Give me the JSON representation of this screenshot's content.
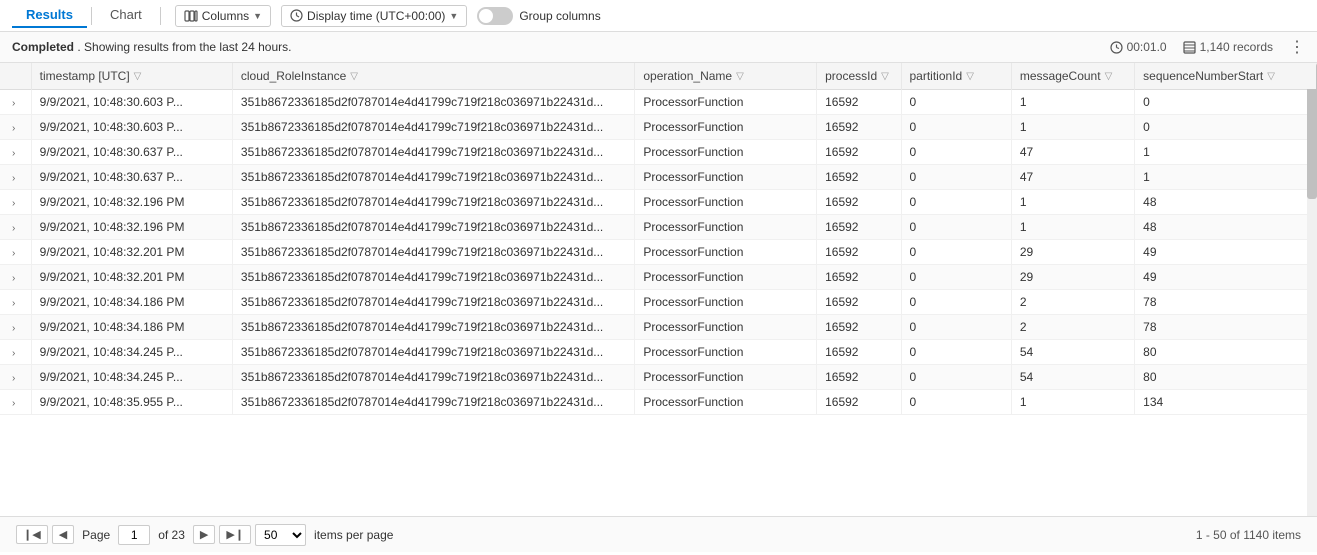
{
  "tabs": [
    {
      "id": "results",
      "label": "Results",
      "active": true
    },
    {
      "id": "chart",
      "label": "Chart",
      "active": false
    }
  ],
  "toolbar": {
    "columns_label": "Columns",
    "display_time_label": "Display time (UTC+00:00)",
    "group_columns_label": "Group columns",
    "toggle_state": "off"
  },
  "status": {
    "completed": "Completed",
    "message": ". Showing results from the last 24 hours.",
    "duration": "00:01.0",
    "records": "1,140 records"
  },
  "table": {
    "columns": [
      {
        "id": "expand",
        "label": ""
      },
      {
        "id": "timestamp",
        "label": "timestamp [UTC]",
        "filter": true
      },
      {
        "id": "cloud_RoleInstance",
        "label": "cloud_RoleInstance",
        "filter": true
      },
      {
        "id": "operation_Name",
        "label": "operation_Name",
        "filter": true
      },
      {
        "id": "processId",
        "label": "processId",
        "filter": true
      },
      {
        "id": "partitionId",
        "label": "partitionId",
        "filter": true
      },
      {
        "id": "messageCount",
        "label": "messageCount",
        "filter": true
      },
      {
        "id": "sequenceNumberStart",
        "label": "sequenceNumberStart",
        "filter": true
      }
    ],
    "rows": [
      {
        "timestamp": "9/9/2021, 10:48:30.603 P...",
        "cloud_RoleInstance": "351b8672336185d2f0787014e4d41799c719f218c036971b22431d...",
        "operation_Name": "ProcessorFunction",
        "processId": "16592",
        "partitionId": "0",
        "messageCount": "1",
        "sequenceNumberStart": "0"
      },
      {
        "timestamp": "9/9/2021, 10:48:30.603 P...",
        "cloud_RoleInstance": "351b8672336185d2f0787014e4d41799c719f218c036971b22431d...",
        "operation_Name": "ProcessorFunction",
        "processId": "16592",
        "partitionId": "0",
        "messageCount": "1",
        "sequenceNumberStart": "0"
      },
      {
        "timestamp": "9/9/2021, 10:48:30.637 P...",
        "cloud_RoleInstance": "351b8672336185d2f0787014e4d41799c719f218c036971b22431d...",
        "operation_Name": "ProcessorFunction",
        "processId": "16592",
        "partitionId": "0",
        "messageCount": "47",
        "sequenceNumberStart": "1"
      },
      {
        "timestamp": "9/9/2021, 10:48:30.637 P...",
        "cloud_RoleInstance": "351b8672336185d2f0787014e4d41799c719f218c036971b22431d...",
        "operation_Name": "ProcessorFunction",
        "processId": "16592",
        "partitionId": "0",
        "messageCount": "47",
        "sequenceNumberStart": "1"
      },
      {
        "timestamp": "9/9/2021, 10:48:32.196 PM",
        "cloud_RoleInstance": "351b8672336185d2f0787014e4d41799c719f218c036971b22431d...",
        "operation_Name": "ProcessorFunction",
        "processId": "16592",
        "partitionId": "0",
        "messageCount": "1",
        "sequenceNumberStart": "48"
      },
      {
        "timestamp": "9/9/2021, 10:48:32.196 PM",
        "cloud_RoleInstance": "351b8672336185d2f0787014e4d41799c719f218c036971b22431d...",
        "operation_Name": "ProcessorFunction",
        "processId": "16592",
        "partitionId": "0",
        "messageCount": "1",
        "sequenceNumberStart": "48"
      },
      {
        "timestamp": "9/9/2021, 10:48:32.201 PM",
        "cloud_RoleInstance": "351b8672336185d2f0787014e4d41799c719f218c036971b22431d...",
        "operation_Name": "ProcessorFunction",
        "processId": "16592",
        "partitionId": "0",
        "messageCount": "29",
        "sequenceNumberStart": "49"
      },
      {
        "timestamp": "9/9/2021, 10:48:32.201 PM",
        "cloud_RoleInstance": "351b8672336185d2f0787014e4d41799c719f218c036971b22431d...",
        "operation_Name": "ProcessorFunction",
        "processId": "16592",
        "partitionId": "0",
        "messageCount": "29",
        "sequenceNumberStart": "49"
      },
      {
        "timestamp": "9/9/2021, 10:48:34.186 PM",
        "cloud_RoleInstance": "351b8672336185d2f0787014e4d41799c719f218c036971b22431d...",
        "operation_Name": "ProcessorFunction",
        "processId": "16592",
        "partitionId": "0",
        "messageCount": "2",
        "sequenceNumberStart": "78"
      },
      {
        "timestamp": "9/9/2021, 10:48:34.186 PM",
        "cloud_RoleInstance": "351b8672336185d2f0787014e4d41799c719f218c036971b22431d...",
        "operation_Name": "ProcessorFunction",
        "processId": "16592",
        "partitionId": "0",
        "messageCount": "2",
        "sequenceNumberStart": "78"
      },
      {
        "timestamp": "9/9/2021, 10:48:34.245 P...",
        "cloud_RoleInstance": "351b8672336185d2f0787014e4d41799c719f218c036971b22431d...",
        "operation_Name": "ProcessorFunction",
        "processId": "16592",
        "partitionId": "0",
        "messageCount": "54",
        "sequenceNumberStart": "80"
      },
      {
        "timestamp": "9/9/2021, 10:48:34.245 P...",
        "cloud_RoleInstance": "351b8672336185d2f0787014e4d41799c719f218c036971b22431d...",
        "operation_Name": "ProcessorFunction",
        "processId": "16592",
        "partitionId": "0",
        "messageCount": "54",
        "sequenceNumberStart": "80"
      },
      {
        "timestamp": "9/9/2021, 10:48:35.955 P...",
        "cloud_RoleInstance": "351b8672336185d2f0787014e4d41799c719f218c036971b22431d...",
        "operation_Name": "ProcessorFunction",
        "processId": "16592",
        "partitionId": "0",
        "messageCount": "1",
        "sequenceNumberStart": "134"
      }
    ]
  },
  "pagination": {
    "page_label": "Page",
    "page_current": "1",
    "page_of": "of 23",
    "page_size": "50",
    "items_info": "1 - 50 of 1140 items",
    "items_per_page": "items per page"
  }
}
